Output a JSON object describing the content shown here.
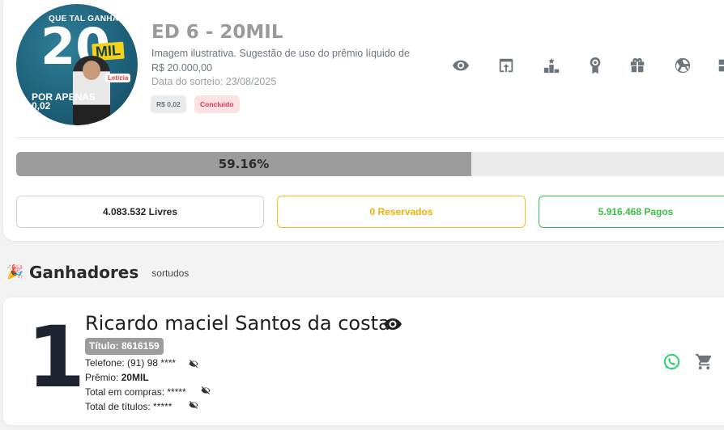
{
  "raffle": {
    "image_text": {
      "line1": "QUE TAL GANHAR",
      "big": "20",
      "mil": "MIL",
      "price_label": "POR APENAS\n0,02",
      "brand": "Letícia"
    },
    "title": "ED 6 - 20MIL",
    "description": "Imagem ilustrativa. Sugestão de uso do prêmio líquido de R$ 20.000,00",
    "draw_date": "Data do sorteio: 23/08/2025",
    "price_badge": "R$ 0,02",
    "status_badge": "Concluído",
    "actions": [
      "eye-icon",
      "share-icon",
      "podium-icon",
      "award-icon",
      "gift-icon",
      "wheel-icon",
      "more-icon"
    ],
    "progress": {
      "percent": 59.16,
      "label": "59.16%"
    },
    "stats": {
      "free": "4.083.532 Livres",
      "reserved": "0 Reservados",
      "paid": "5.916.468 Pagos"
    }
  },
  "winners": {
    "icon": "🎉",
    "title": "Ganhadores",
    "subtitle": "sortudos",
    "items": [
      {
        "rank": "1",
        "name": "Ricardo maciel Santos da costa",
        "ticket": "Título: 8616159",
        "phone_label": "Telefone: (91) 98 ****",
        "prize_label": "Prêmio: ",
        "prize_value": "20MIL",
        "total_purchases": "Total em compras: *****",
        "total_titles": "Total de títulos: *****"
      }
    ]
  },
  "colors": {
    "progress_fill": "#9c9c9c",
    "reserved": "#e9b308",
    "paid": "#3cbf4a",
    "status": "#d9364a",
    "whatsapp": "#25d366"
  }
}
